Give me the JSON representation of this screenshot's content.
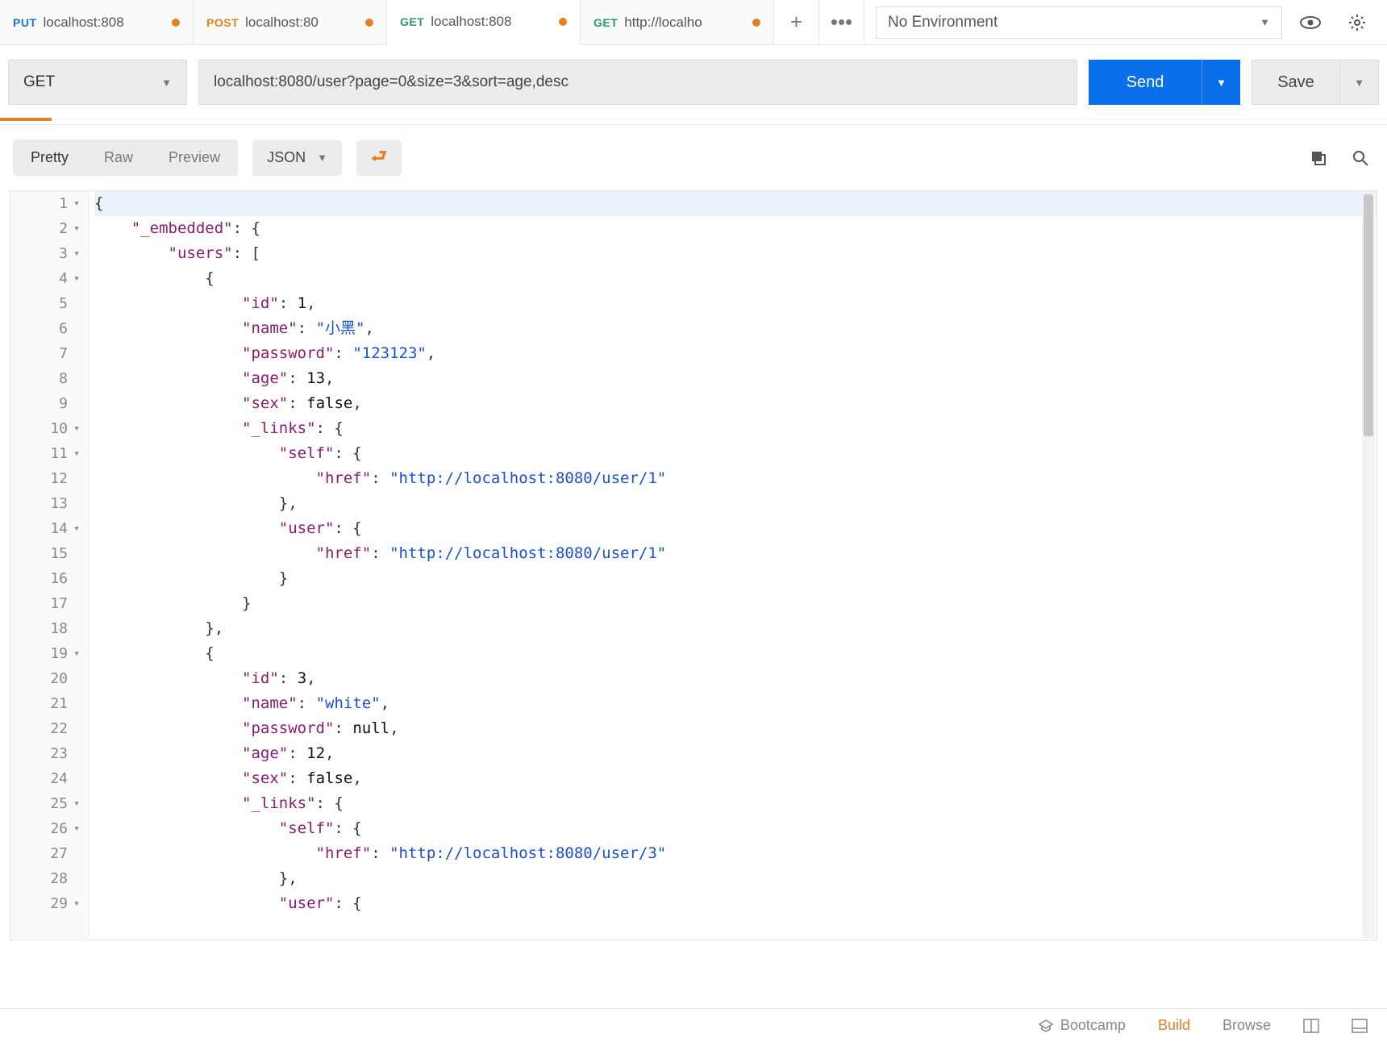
{
  "tabs": [
    {
      "method": "PUT",
      "methodClass": "put",
      "label": "localhost:808",
      "dirty": true
    },
    {
      "method": "POST",
      "methodClass": "post",
      "label": "localhost:80",
      "dirty": true
    },
    {
      "method": "GET",
      "methodClass": "get",
      "label": "localhost:808",
      "dirty": true,
      "active": true
    },
    {
      "method": "GET",
      "methodClass": "get",
      "label": "http://localho",
      "dirty": true
    }
  ],
  "env": {
    "selected": "No Environment"
  },
  "request": {
    "method": "GET",
    "url": "localhost:8080/user?page=0&size=3&sort=age,desc",
    "send": "Send",
    "save": "Save"
  },
  "responseBar": {
    "views": [
      "Pretty",
      "Raw",
      "Preview"
    ],
    "activeView": 0,
    "format": "JSON"
  },
  "responseBody": {
    "_embedded": {
      "users": [
        {
          "id": 1,
          "name": "小黑",
          "password": "123123",
          "age": 13,
          "sex": false,
          "_links": {
            "self": {
              "href": "http://localhost:8080/user/1"
            },
            "user": {
              "href": "http://localhost:8080/user/1"
            }
          }
        },
        {
          "id": 3,
          "name": "white",
          "password": null,
          "age": 12,
          "sex": false,
          "_links": {
            "self": {
              "href": "http://localhost:8080/user/3"
            },
            "user": {
              "href": ""
            }
          }
        }
      ]
    }
  },
  "gutter": {
    "foldable": [
      1,
      2,
      3,
      4,
      10,
      11,
      14,
      19,
      25,
      26,
      29
    ],
    "max": 29
  },
  "footer": {
    "bootcamp": "Bootcamp",
    "build": "Build",
    "browse": "Browse"
  }
}
